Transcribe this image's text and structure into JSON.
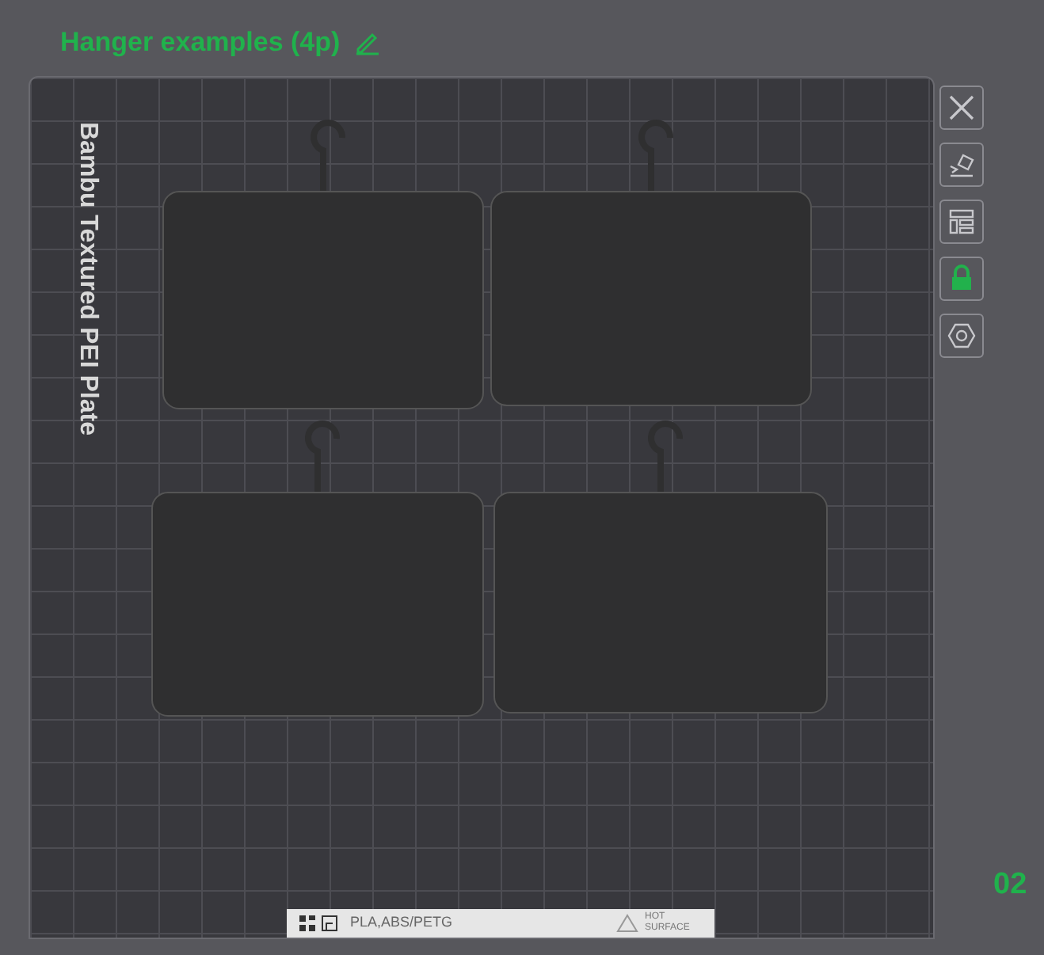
{
  "project": {
    "title": "Hanger examples (4p)"
  },
  "plate": {
    "name": "Bambu Textured PEI Plate",
    "number": "02",
    "materials": "PLA,ABS/PETG",
    "warning": "HOT SURFACE"
  },
  "objects": [
    {
      "selected": false
    },
    {
      "selected": false
    },
    {
      "selected": false
    },
    {
      "selected": false
    }
  ],
  "tools": [
    {
      "kind": "close",
      "on": false
    },
    {
      "kind": "orient",
      "on": false
    },
    {
      "kind": "arrange",
      "on": false
    },
    {
      "kind": "lock",
      "on": true
    },
    {
      "kind": "settings",
      "on": false
    }
  ]
}
